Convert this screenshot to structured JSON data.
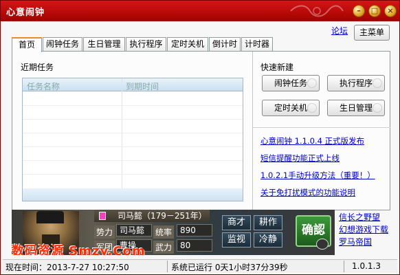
{
  "window": {
    "title": "心意闹钟",
    "controls": [
      "minimize-icon",
      "maximize-icon",
      "close-icon"
    ],
    "accent_color": "#b30a0a"
  },
  "toolbar": {
    "forum_label": "论坛",
    "main_menu_label": "主菜单"
  },
  "tabs": [
    {
      "label": "首页",
      "active": true
    },
    {
      "label": "闹钟任务",
      "active": false
    },
    {
      "label": "生日管理",
      "active": false
    },
    {
      "label": "执行程序",
      "active": false
    },
    {
      "label": "定时关机",
      "active": false
    },
    {
      "label": "倒计时",
      "active": false
    },
    {
      "label": "计时器",
      "active": false
    }
  ],
  "home": {
    "recent_label": "近期任务",
    "table": {
      "columns": [
        "任务名称",
        "到期时间"
      ],
      "rows": []
    },
    "quick_label": "快速新建",
    "quick_buttons": [
      "闹钟任务",
      "执行程序",
      "定时关机",
      "生日管理"
    ],
    "news": [
      "心意闹钟 1.1.0.4 正式版发布",
      "短信提醒功能正式上线",
      "1.0.2.1手动升级方法（重要！）",
      "关于免打扰模式的功能说明"
    ]
  },
  "ad": {
    "hero_name": "司马懿（179－251年）",
    "rows": [
      {
        "label": "势力",
        "value": "司马懿",
        "label2": "统率",
        "value2": "890"
      },
      {
        "label": "军团",
        "value": "曹操",
        "label2": "武力",
        "value2": "80"
      }
    ],
    "buttons": [
      "商才",
      "耕作",
      "监视",
      "冷静"
    ],
    "confirm_label": "确認",
    "watermark": "数码资源 Smzy.Com",
    "side_links": [
      "信长之野望",
      "幻想游戏下载",
      "罗马帝国"
    ]
  },
  "status": {
    "current_time": "现在时间：2013-7-27 10:27:50",
    "running_time": "系统已运行 0天1小时37分39秒",
    "version": "1.0.1.3"
  }
}
